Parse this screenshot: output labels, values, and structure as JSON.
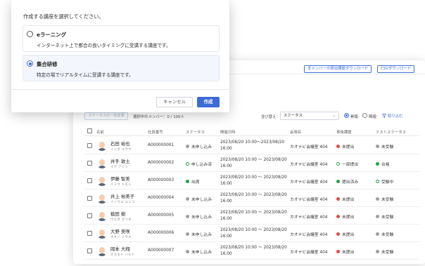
{
  "modal": {
    "title": "作成する講座を選択してください。",
    "options": [
      {
        "title": "eラーニング",
        "description": "インターネット上で都合の良いタイミングに受講する講座です。",
        "selected": false
      },
      {
        "title": "集合研修",
        "description": "特定の場でリアルタイムに受講する講座です。",
        "selected": true
      }
    ],
    "cancel_label": "キャンセル",
    "create_label": "作成"
  },
  "app": {
    "download_all_label": "全メンバーの提出課題ダウンロード",
    "csv_download_label": "CSVダウンロード",
    "status_change_label": "ステータスの一括変更",
    "selected_members": "選択中のメンバー：0 / 100人",
    "sort_label": "並び替え：",
    "sort_value": "ステータス",
    "asc_label": "昇順",
    "desc_label": "降順",
    "asc_selected": true,
    "filter_label": "絞り込む",
    "colors": {
      "accent": "#3c6bd6",
      "red": "#e34a3c",
      "green": "#23a04a",
      "grey": "#9aa0a6"
    },
    "columns": [
      "名前",
      "社員番号",
      "ステータス",
      "開催日時",
      "会場名",
      "事後課題",
      "テストステータス"
    ],
    "rows": [
      {
        "name": "石田 裕也",
        "kana": "イシダ ユウヤ",
        "id": "A000000001",
        "status": "未申し込み",
        "status_icon": "grey",
        "date": "2023/08/20 10:00〜2023/08/20 16:00",
        "venue": "カオナビ会議室 404",
        "task": "未提出",
        "task_icon": "red",
        "test": "未受験",
        "test_icon": "grey"
      },
      {
        "name": "井手 敦士",
        "kana": "イデ アツシ",
        "id": "A000000002",
        "status": "申し込み済",
        "status_icon": "ring",
        "date": "2023/08/20 10:00 〜 2023/08/20 16:00",
        "venue": "カオナビ会議室 404",
        "task": "一部提出",
        "task_icon": "ring",
        "test": "合格",
        "test_icon": "green"
      },
      {
        "name": "伊藤 智美",
        "kana": "イトウ トモミ",
        "id": "A000000003",
        "status": "出席",
        "status_icon": "green",
        "date": "2023/08/20 10:00 〜 2023/08/20 16:00",
        "venue": "カオナビ会議室 404",
        "task": "提出済み",
        "task_icon": "green",
        "test": "受験中",
        "test_icon": "ring"
      },
      {
        "name": "井上 裕美子",
        "kana": "イノウエ ユミコ",
        "id": "A000000004",
        "status": "未申し込み",
        "status_icon": "grey",
        "date": "2023/08/20 10:00 〜 2023/08/20 16:00",
        "venue": "カオナビ会議室 404",
        "task": "未提出",
        "task_icon": "red",
        "test": "未受験",
        "test_icon": "grey"
      },
      {
        "name": "植田 樹",
        "kana": "ウエダ タツキ",
        "id": "A000000005",
        "status": "未申し込み",
        "status_icon": "grey",
        "date": "2023/08/20 10:00 〜 2023/08/20 16:00",
        "venue": "カオナビ会議室 404",
        "task": "未提出",
        "task_icon": "red",
        "test": "未受験",
        "test_icon": "grey"
      },
      {
        "name": "大野 美咲",
        "kana": "オオノ ミサキ",
        "id": "A000000006",
        "status": "未申し込み",
        "status_icon": "grey",
        "date": "2023/08/20 10:00 〜 2023/08/20 16:00",
        "venue": "カオナビ会議室 404",
        "task": "未提出",
        "task_icon": "red",
        "test": "未受験",
        "test_icon": "grey"
      },
      {
        "name": "岡本 大翔",
        "kana": "オカモト ハルト",
        "id": "A000000007",
        "status": "未申し込み",
        "status_icon": "grey",
        "date": "2023/08/20 10:00 〜 2023/08/20 16:00",
        "venue": "カオナビ会議室 404",
        "task": "未提出",
        "task_icon": "red",
        "test": "未受験",
        "test_icon": "grey"
      }
    ]
  }
}
